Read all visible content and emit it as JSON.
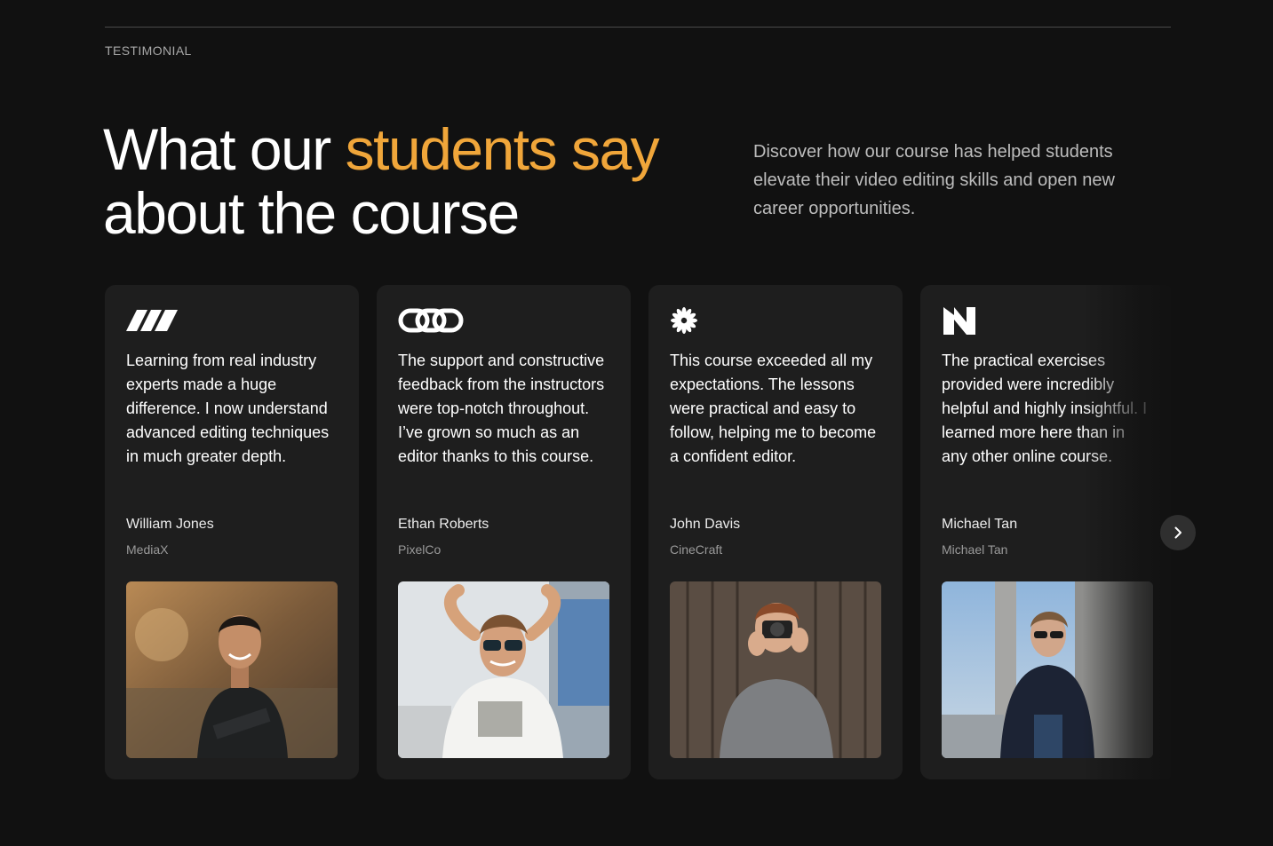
{
  "section": {
    "eyebrow": "TESTIMONIAL",
    "headline_pre": "What our ",
    "headline_accent": "students say",
    "headline_post": "about the course",
    "intro": "Discover how our course has helped students elevate their video editing skills and open new career opportunities.",
    "accent_color": "#f0a63a"
  },
  "testimonials": [
    {
      "logo_icon": "slashes-logo-icon",
      "quote": "Learning from real industry experts made a huge difference. I now understand advanced editing techniques in much greater depth.",
      "name": "William Jones",
      "company": "MediaX"
    },
    {
      "logo_icon": "chain-links-logo-icon",
      "quote": "The support and constructive feedback from the instructors were top-notch throughout. I’ve grown so much as an editor thanks to this course.",
      "name": "Ethan Roberts",
      "company": "PixelCo"
    },
    {
      "logo_icon": "starburst-logo-icon",
      "quote": "This course exceeded all my expectations. The lessons were practical and easy to follow, helping me to become a confident editor.",
      "name": "John Davis",
      "company": "CineCraft"
    },
    {
      "logo_icon": "letter-n-logo-icon",
      "quote": "The practical exercises provided were incredibly helpful and highly insightful. I learned more here than in any other online course.",
      "name": "Michael Tan",
      "company": "Michael Tan"
    }
  ],
  "carousel": {
    "next_icon": "chevron-right-icon"
  }
}
